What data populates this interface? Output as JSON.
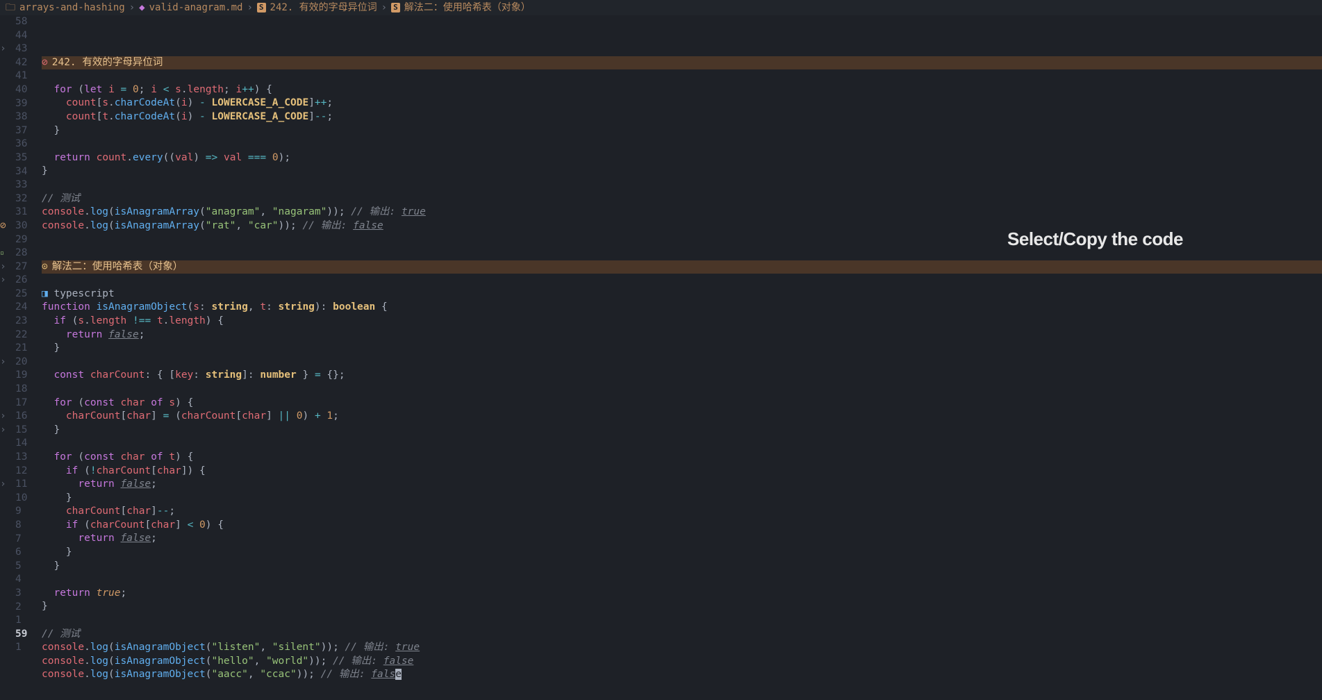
{
  "breadcrumb": {
    "folder": "arrays-and-hashing",
    "file": "valid-anagram.md",
    "section1": "242. 有效的字母异位词",
    "section2": "解法二：使用哈希表（对象）"
  },
  "heading1": "242. 有效的字母异位词",
  "heading2": "解法二：使用哈希表（对象）",
  "overlay": "Select/Copy the code",
  "lang_label": "typescript",
  "lines": [
    {
      "n": 58,
      "sign": "",
      "type": "heading1"
    },
    {
      "n": 44,
      "sign": "",
      "tokens": []
    },
    {
      "n": 43,
      "sign": "fold",
      "tokens": [
        [
          "  ",
          ""
        ],
        [
          "for",
          "kw"
        ],
        [
          " (",
          ""
        ],
        [
          "let",
          "kw"
        ],
        [
          " ",
          ""
        ],
        [
          "i",
          "var"
        ],
        [
          " ",
          ""
        ],
        [
          "=",
          "op"
        ],
        [
          " ",
          ""
        ],
        [
          "0",
          "num"
        ],
        [
          "; ",
          ""
        ],
        [
          "i",
          "var"
        ],
        [
          " ",
          ""
        ],
        [
          "<",
          "op"
        ],
        [
          " ",
          ""
        ],
        [
          "s",
          "var"
        ],
        [
          ".",
          ""
        ],
        [
          "length",
          "prop"
        ],
        [
          "; ",
          ""
        ],
        [
          "i",
          "var"
        ],
        [
          "++",
          "op"
        ],
        [
          ") {",
          ""
        ]
      ]
    },
    {
      "n": 42,
      "sign": "",
      "tokens": [
        [
          "    ",
          ""
        ],
        [
          "count",
          "var"
        ],
        [
          "[",
          ""
        ],
        [
          "s",
          "var"
        ],
        [
          ".",
          ""
        ],
        [
          "charCodeAt",
          "fn"
        ],
        [
          "(",
          ""
        ],
        [
          "i",
          "var"
        ],
        [
          ") ",
          ""
        ],
        [
          "-",
          "op"
        ],
        [
          " ",
          ""
        ],
        [
          "LOWERCASE_A_CODE",
          "const"
        ],
        [
          "]",
          ""
        ],
        [
          "++",
          "op"
        ],
        [
          ";",
          ""
        ]
      ]
    },
    {
      "n": 41,
      "sign": "",
      "tokens": [
        [
          "    ",
          ""
        ],
        [
          "count",
          "var"
        ],
        [
          "[",
          ""
        ],
        [
          "t",
          "var"
        ],
        [
          ".",
          ""
        ],
        [
          "charCodeAt",
          "fn"
        ],
        [
          "(",
          ""
        ],
        [
          "i",
          "var"
        ],
        [
          ") ",
          ""
        ],
        [
          "-",
          "op"
        ],
        [
          " ",
          ""
        ],
        [
          "LOWERCASE_A_CODE",
          "const"
        ],
        [
          "]",
          ""
        ],
        [
          "--",
          "op"
        ],
        [
          ";",
          ""
        ]
      ]
    },
    {
      "n": 40,
      "sign": "",
      "tokens": [
        [
          "  }",
          ""
        ]
      ]
    },
    {
      "n": 39,
      "sign": "",
      "tokens": []
    },
    {
      "n": 38,
      "sign": "",
      "tokens": [
        [
          "  ",
          ""
        ],
        [
          "return",
          "kw"
        ],
        [
          " ",
          ""
        ],
        [
          "count",
          "var"
        ],
        [
          ".",
          ""
        ],
        [
          "every",
          "fn"
        ],
        [
          "((",
          ""
        ],
        [
          "val",
          "var"
        ],
        [
          ") ",
          ""
        ],
        [
          "=>",
          "op"
        ],
        [
          " ",
          ""
        ],
        [
          "val",
          "var"
        ],
        [
          " ",
          ""
        ],
        [
          "===",
          "op"
        ],
        [
          " ",
          ""
        ],
        [
          "0",
          "num"
        ],
        [
          ");",
          ""
        ]
      ]
    },
    {
      "n": 37,
      "sign": "",
      "tokens": [
        [
          "}",
          ""
        ]
      ]
    },
    {
      "n": 36,
      "sign": "",
      "tokens": []
    },
    {
      "n": 35,
      "sign": "",
      "tokens": [
        [
          "// 测试",
          "cm"
        ]
      ]
    },
    {
      "n": 34,
      "sign": "",
      "tokens": [
        [
          "console",
          "var"
        ],
        [
          ".",
          ""
        ],
        [
          "log",
          "fn"
        ],
        [
          "(",
          ""
        ],
        [
          "isAnagramArray",
          "fn"
        ],
        [
          "(",
          ""
        ],
        [
          "\"anagram\"",
          "str"
        ],
        [
          ", ",
          ""
        ],
        [
          "\"nagaram\"",
          "str"
        ],
        [
          ")); ",
          ""
        ],
        [
          "// 输出: ",
          "cm"
        ],
        [
          "true",
          "cmval"
        ]
      ]
    },
    {
      "n": 33,
      "sign": "",
      "tokens": [
        [
          "console",
          "var"
        ],
        [
          ".",
          ""
        ],
        [
          "log",
          "fn"
        ],
        [
          "(",
          ""
        ],
        [
          "isAnagramArray",
          "fn"
        ],
        [
          "(",
          ""
        ],
        [
          "\"rat\"",
          "str"
        ],
        [
          ", ",
          ""
        ],
        [
          "\"car\"",
          "str"
        ],
        [
          ")); ",
          ""
        ],
        [
          "// 输出: ",
          "cm"
        ],
        [
          "false",
          "cmval"
        ]
      ]
    },
    {
      "n": 32,
      "sign": "",
      "tokens": []
    },
    {
      "n": 31,
      "sign": "",
      "tokens": []
    },
    {
      "n": 30,
      "sign": "diag",
      "type": "heading2"
    },
    {
      "n": 29,
      "sign": "",
      "tokens": []
    },
    {
      "n": 28,
      "sign": "add",
      "type": "lang"
    },
    {
      "n": 27,
      "sign": "fold",
      "tokens": [
        [
          "function",
          "kw"
        ],
        [
          " ",
          ""
        ],
        [
          "isAnagramObject",
          "fn"
        ],
        [
          "(",
          ""
        ],
        [
          "s",
          "var"
        ],
        [
          ": ",
          ""
        ],
        [
          "string",
          "type"
        ],
        [
          ", ",
          ""
        ],
        [
          "t",
          "var"
        ],
        [
          ": ",
          ""
        ],
        [
          "string",
          "type"
        ],
        [
          "): ",
          ""
        ],
        [
          "boolean",
          "type"
        ],
        [
          " {",
          ""
        ]
      ]
    },
    {
      "n": 26,
      "sign": "fold",
      "tokens": [
        [
          "  ",
          ""
        ],
        [
          "if",
          "kw"
        ],
        [
          " (",
          ""
        ],
        [
          "s",
          "var"
        ],
        [
          ".",
          ""
        ],
        [
          "length",
          "prop"
        ],
        [
          " ",
          ""
        ],
        [
          "!==",
          "op"
        ],
        [
          " ",
          ""
        ],
        [
          "t",
          "var"
        ],
        [
          ".",
          ""
        ],
        [
          "length",
          "prop"
        ],
        [
          ") {",
          ""
        ]
      ]
    },
    {
      "n": 25,
      "sign": "",
      "tokens": [
        [
          "    ",
          ""
        ],
        [
          "return",
          "kw"
        ],
        [
          " ",
          ""
        ],
        [
          "false",
          "cmval"
        ],
        [
          ";",
          ""
        ]
      ]
    },
    {
      "n": 24,
      "sign": "",
      "tokens": [
        [
          "  }",
          ""
        ]
      ]
    },
    {
      "n": 23,
      "sign": "",
      "tokens": []
    },
    {
      "n": 22,
      "sign": "",
      "tokens": [
        [
          "  ",
          ""
        ],
        [
          "const",
          "kw"
        ],
        [
          " ",
          ""
        ],
        [
          "charCount",
          "var"
        ],
        [
          ": { [",
          ""
        ],
        [
          "key",
          "var"
        ],
        [
          ": ",
          ""
        ],
        [
          "string",
          "type"
        ],
        [
          "]: ",
          ""
        ],
        [
          "number",
          "type"
        ],
        [
          " } ",
          ""
        ],
        [
          "=",
          "op"
        ],
        [
          " {};",
          ""
        ]
      ]
    },
    {
      "n": 21,
      "sign": "",
      "tokens": []
    },
    {
      "n": 20,
      "sign": "fold",
      "tokens": [
        [
          "  ",
          ""
        ],
        [
          "for",
          "kw"
        ],
        [
          " (",
          ""
        ],
        [
          "const",
          "kw"
        ],
        [
          " ",
          ""
        ],
        [
          "char",
          "var"
        ],
        [
          " ",
          ""
        ],
        [
          "of",
          "kw"
        ],
        [
          " ",
          ""
        ],
        [
          "s",
          "var"
        ],
        [
          ") {",
          ""
        ]
      ]
    },
    {
      "n": 19,
      "sign": "",
      "tokens": [
        [
          "    ",
          ""
        ],
        [
          "charCount",
          "var"
        ],
        [
          "[",
          ""
        ],
        [
          "char",
          "var"
        ],
        [
          "] ",
          ""
        ],
        [
          "=",
          "op"
        ],
        [
          " (",
          ""
        ],
        [
          "charCount",
          "var"
        ],
        [
          "[",
          ""
        ],
        [
          "char",
          "var"
        ],
        [
          "] ",
          ""
        ],
        [
          "||",
          "op"
        ],
        [
          " ",
          ""
        ],
        [
          "0",
          "num"
        ],
        [
          ") ",
          ""
        ],
        [
          "+",
          "op"
        ],
        [
          " ",
          ""
        ],
        [
          "1",
          "num"
        ],
        [
          ";",
          ""
        ]
      ]
    },
    {
      "n": 18,
      "sign": "",
      "tokens": [
        [
          "  }",
          ""
        ]
      ]
    },
    {
      "n": 17,
      "sign": "",
      "tokens": []
    },
    {
      "n": 16,
      "sign": "fold",
      "tokens": [
        [
          "  ",
          ""
        ],
        [
          "for",
          "kw"
        ],
        [
          " (",
          ""
        ],
        [
          "const",
          "kw"
        ],
        [
          " ",
          ""
        ],
        [
          "char",
          "var"
        ],
        [
          " ",
          ""
        ],
        [
          "of",
          "kw"
        ],
        [
          " ",
          ""
        ],
        [
          "t",
          "var"
        ],
        [
          ") {",
          ""
        ]
      ]
    },
    {
      "n": 15,
      "sign": "fold",
      "tokens": [
        [
          "    ",
          ""
        ],
        [
          "if",
          "kw"
        ],
        [
          " (",
          ""
        ],
        [
          "!",
          "op"
        ],
        [
          "charCount",
          "var"
        ],
        [
          "[",
          ""
        ],
        [
          "char",
          "var"
        ],
        [
          "]) {",
          ""
        ]
      ]
    },
    {
      "n": 14,
      "sign": "",
      "tokens": [
        [
          "      ",
          ""
        ],
        [
          "return",
          "kw"
        ],
        [
          " ",
          ""
        ],
        [
          "false",
          "cmval"
        ],
        [
          ";",
          ""
        ]
      ]
    },
    {
      "n": 13,
      "sign": "",
      "tokens": [
        [
          "    }",
          ""
        ]
      ]
    },
    {
      "n": 12,
      "sign": "",
      "tokens": [
        [
          "    ",
          ""
        ],
        [
          "charCount",
          "var"
        ],
        [
          "[",
          ""
        ],
        [
          "char",
          "var"
        ],
        [
          "]",
          ""
        ],
        [
          "--",
          "op"
        ],
        [
          ";",
          ""
        ]
      ]
    },
    {
      "n": 11,
      "sign": "fold",
      "tokens": [
        [
          "    ",
          ""
        ],
        [
          "if",
          "kw"
        ],
        [
          " (",
          ""
        ],
        [
          "charCount",
          "var"
        ],
        [
          "[",
          ""
        ],
        [
          "char",
          "var"
        ],
        [
          "] ",
          ""
        ],
        [
          "<",
          "op"
        ],
        [
          " ",
          ""
        ],
        [
          "0",
          "num"
        ],
        [
          ") {",
          ""
        ]
      ]
    },
    {
      "n": 10,
      "sign": "",
      "tokens": [
        [
          "      ",
          ""
        ],
        [
          "return",
          "kw"
        ],
        [
          " ",
          ""
        ],
        [
          "false",
          "cmval"
        ],
        [
          ";",
          ""
        ]
      ]
    },
    {
      "n": 9,
      "sign": "",
      "tokens": [
        [
          "    }",
          ""
        ]
      ]
    },
    {
      "n": 8,
      "sign": "",
      "tokens": [
        [
          "  }",
          ""
        ]
      ]
    },
    {
      "n": 7,
      "sign": "",
      "tokens": []
    },
    {
      "n": 6,
      "sign": "",
      "tokens": [
        [
          "  ",
          ""
        ],
        [
          "return",
          "kw"
        ],
        [
          " ",
          ""
        ],
        [
          "true",
          "bool"
        ],
        [
          ";",
          ""
        ]
      ]
    },
    {
      "n": 5,
      "sign": "",
      "tokens": [
        [
          "}",
          ""
        ]
      ]
    },
    {
      "n": 4,
      "sign": "",
      "tokens": []
    },
    {
      "n": 3,
      "sign": "",
      "tokens": [
        [
          "// 测试",
          "cm"
        ]
      ]
    },
    {
      "n": 2,
      "sign": "",
      "tokens": [
        [
          "console",
          "var"
        ],
        [
          ".",
          ""
        ],
        [
          "log",
          "fn"
        ],
        [
          "(",
          ""
        ],
        [
          "isAnagramObject",
          "fn"
        ],
        [
          "(",
          ""
        ],
        [
          "\"listen\"",
          "str"
        ],
        [
          ", ",
          ""
        ],
        [
          "\"silent\"",
          "str"
        ],
        [
          ")); ",
          ""
        ],
        [
          "// 输出: ",
          "cm"
        ],
        [
          "true",
          "cmval"
        ]
      ]
    },
    {
      "n": 1,
      "sign": "",
      "tokens": [
        [
          "console",
          "var"
        ],
        [
          ".",
          ""
        ],
        [
          "log",
          "fn"
        ],
        [
          "(",
          ""
        ],
        [
          "isAnagramObject",
          "fn"
        ],
        [
          "(",
          ""
        ],
        [
          "\"hello\"",
          "str"
        ],
        [
          ", ",
          ""
        ],
        [
          "\"world\"",
          "str"
        ],
        [
          ")); ",
          ""
        ],
        [
          "// 输出: ",
          "cm"
        ],
        [
          "false",
          "cmval"
        ]
      ]
    },
    {
      "n": 59,
      "sign": "",
      "cur": true,
      "tokens": [
        [
          "console",
          "var"
        ],
        [
          ".",
          ""
        ],
        [
          "log",
          "fn"
        ],
        [
          "(",
          ""
        ],
        [
          "isAnagramObject",
          "fn"
        ],
        [
          "(",
          ""
        ],
        [
          "\"aacc\"",
          "str"
        ],
        [
          ", ",
          ""
        ],
        [
          "\"ccac\"",
          "str"
        ],
        [
          ")); ",
          ""
        ],
        [
          "// 输出: ",
          "cm"
        ],
        [
          "fals",
          "cmval"
        ],
        [
          "e",
          "cursor"
        ]
      ]
    },
    {
      "n": 1,
      "sign": "",
      "tokens": []
    }
  ]
}
